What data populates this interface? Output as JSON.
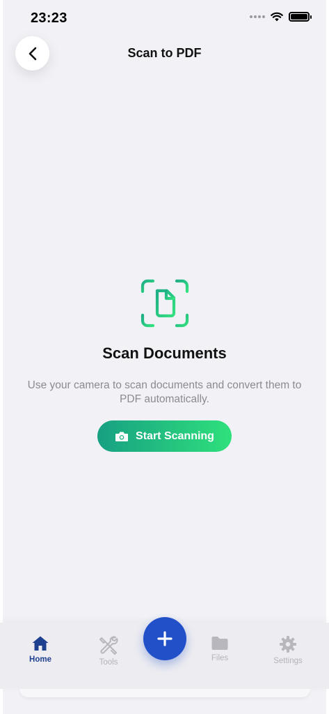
{
  "status_bar": {
    "time": "23:23"
  },
  "header": {
    "title": "Scan to PDF"
  },
  "hero": {
    "title": "Scan Documents",
    "description": "Use your camera to scan documents and convert them to PDF automatically.",
    "button_label": "Start Scanning",
    "accent_color": "#2ecf80"
  },
  "tabbar": {
    "tabs": [
      {
        "label": "Home",
        "icon": "home-icon",
        "active": true
      },
      {
        "label": "Tools",
        "icon": "tools-icon",
        "active": false
      },
      {
        "label": "Files",
        "icon": "folder-icon",
        "active": false
      },
      {
        "label": "Settings",
        "icon": "gear-icon",
        "active": false
      }
    ],
    "fab_icon": "plus-icon",
    "active_color": "#1f3f8f",
    "fab_color": "#2250c9"
  }
}
